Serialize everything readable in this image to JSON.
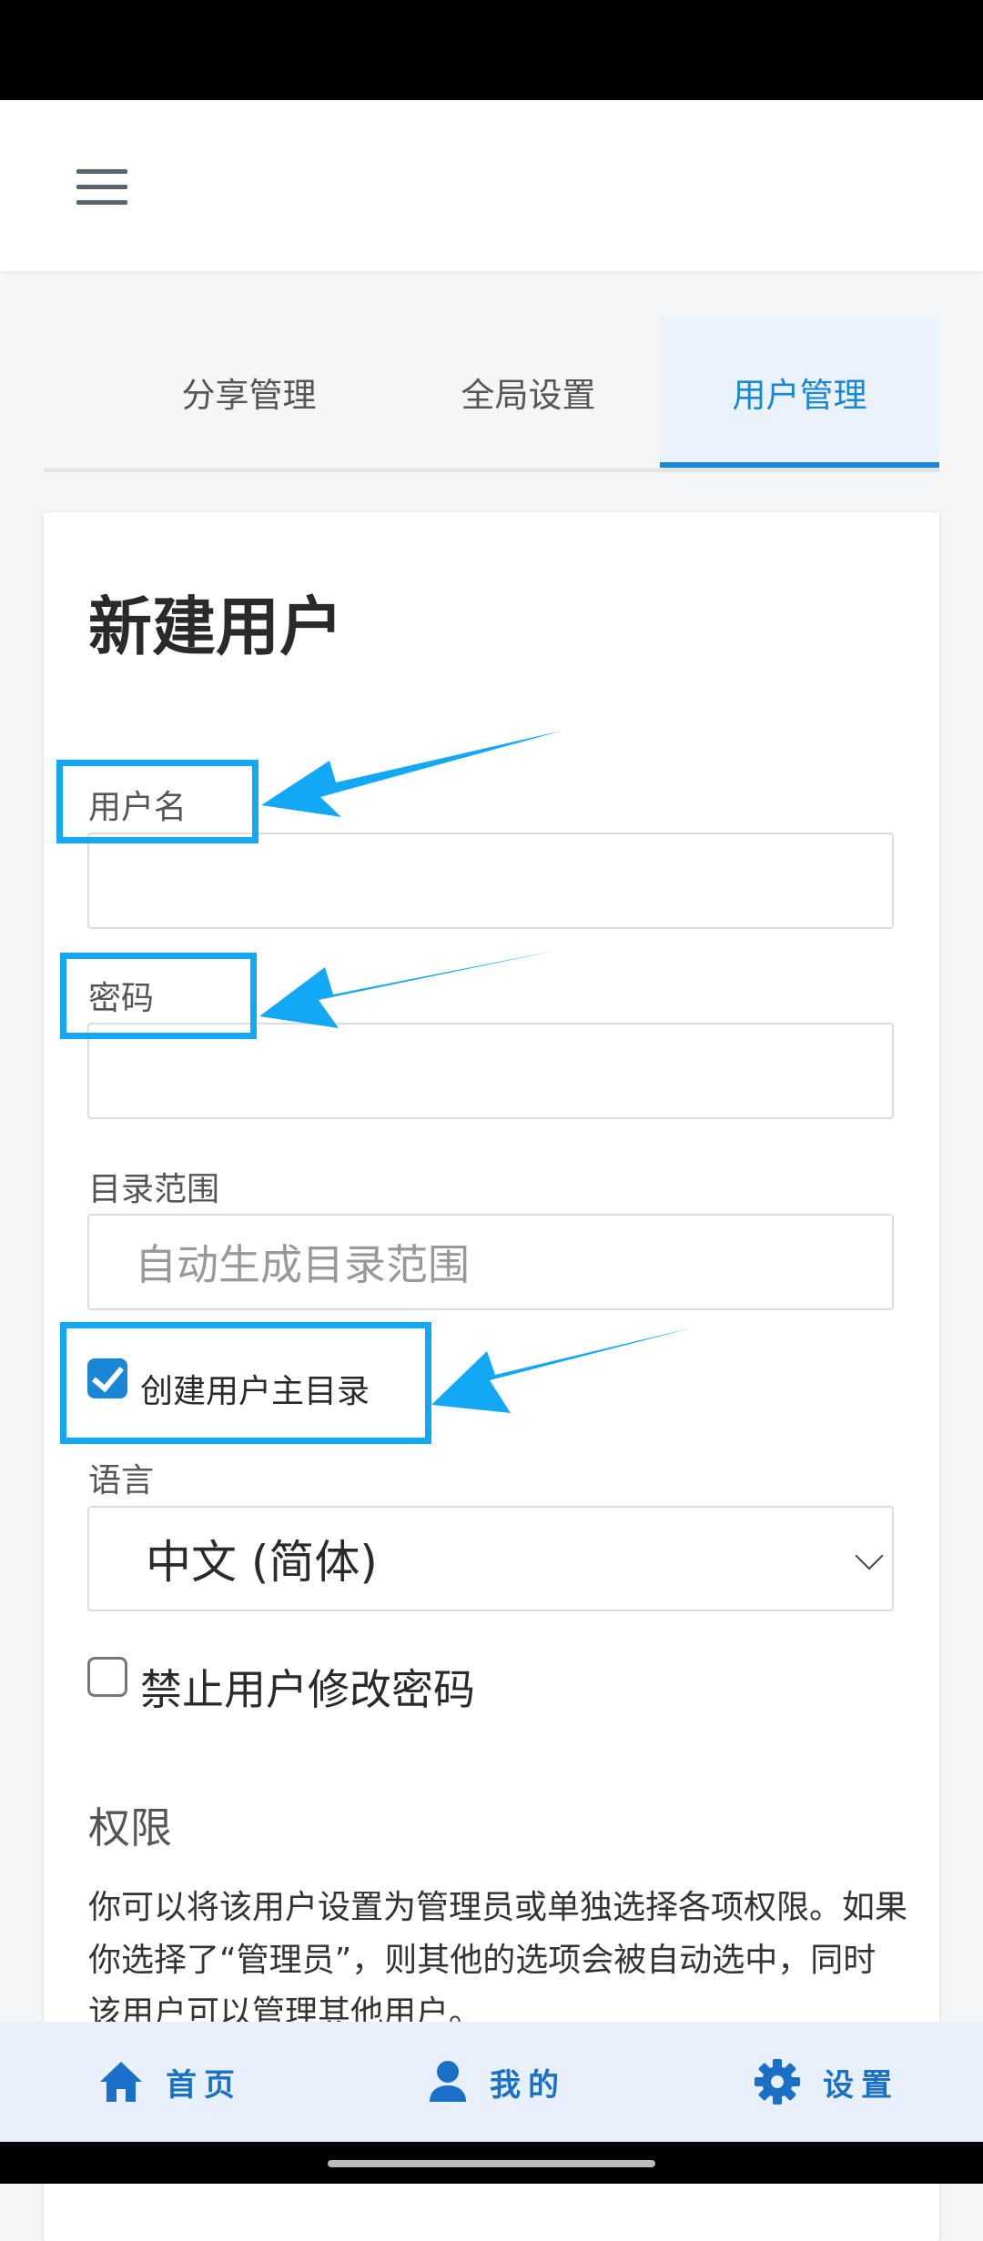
{
  "tabs": [
    {
      "label": "分享管理"
    },
    {
      "label": "全局设置"
    },
    {
      "label": "用户管理",
      "active": true
    }
  ],
  "form": {
    "title": "新建用户",
    "username_label": "用户名",
    "username_value": "",
    "password_label": "密码",
    "password_value": "",
    "scope_label": "目录范围",
    "scope_placeholder": "自动生成目录范围",
    "create_home_label": "创建用户主目录",
    "create_home_checked": true,
    "language_label": "语言",
    "language_value": "中文 (简体)",
    "lock_password_label": "禁止用户修改密码",
    "lock_password_checked": false,
    "permissions_title": "权限",
    "permissions_desc": "你可以将该用户设置为管理员或单独选择各项权限。如果你选择了“管理员”，则其他的选项会被自动选中，同时该用户可以管理其他用户。"
  },
  "bottom_nav": [
    {
      "label": "首页",
      "icon": "home-icon"
    },
    {
      "label": "我的",
      "icon": "person-icon"
    },
    {
      "label": "设置",
      "icon": "gear-icon"
    }
  ],
  "colors": {
    "accent": "#1a86d8",
    "annotation": "#12a8f5",
    "nav_bg": "#e8f1fb"
  }
}
